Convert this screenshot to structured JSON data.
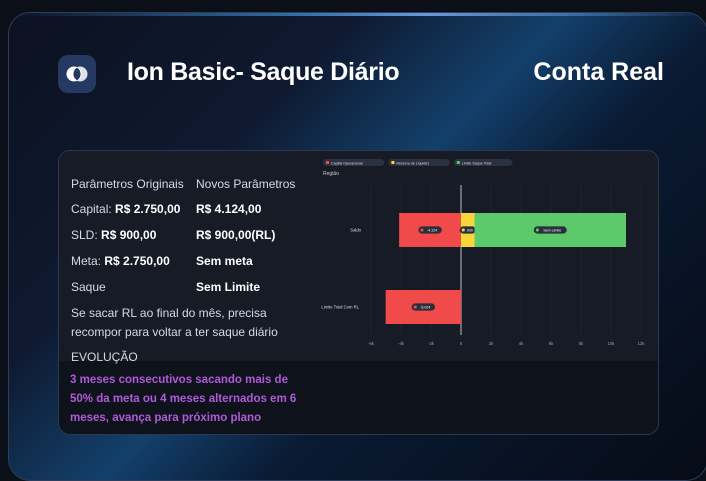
{
  "header": {
    "title": "Ion Basic- Saque Diário",
    "account_type": "Conta Real"
  },
  "params": {
    "col1_header": "Parâmetros Originais",
    "col2_header": "Novos Parâmetros",
    "capital_label": "Capital:",
    "capital_original": "R$ 2.750,00",
    "capital_new": "R$ 4.124,00",
    "sld_label": "SLD:",
    "sld_original": "R$ 900,00",
    "sld_new": "R$ 900,00(RL)",
    "meta_label": "Meta:",
    "meta_original": "R$ 2.750,00",
    "meta_new": "Sem meta",
    "saque_label": "Saque",
    "saque_new": "Sem Limite",
    "note_line1": "Se sacar RL ao final do mês, precisa",
    "note_line2": "recompor para voltar a ter saque diário",
    "evolucao": "EVOLUÇÃO"
  },
  "footer_note": "3 meses consecutivos sacando mais de 50% da meta ou 4 meses alternados em 6 meses, avança para próximo plano",
  "colors": {
    "red": "#f04a4a",
    "yellow": "#f7d63c",
    "green": "#5cc96b",
    "purple_note": "#b05ad9"
  },
  "chart_data": {
    "type": "bar",
    "orientation": "horizontal",
    "stacked": true,
    "title": "Região",
    "legend": [
      "Capital Operacional",
      "Reserva de Liquidez",
      "Limite Saque Total"
    ],
    "legend_placement": "top-left",
    "categories": [
      "Saldo",
      "Limite Total Com RL"
    ],
    "series": [
      {
        "name": "Capital Operacional",
        "color": "#f04a4a",
        "values": [
          -4.124,
          -5.024
        ],
        "labels": [
          "-4,124",
          "-5,024"
        ]
      },
      {
        "name": "Reserva de Liquidez",
        "color": "#f7d63c",
        "values": [
          0.9,
          0
        ],
        "labels": [
          "900",
          ""
        ]
      },
      {
        "name": "Limite Saque Total",
        "color": "#5cc96b",
        "values": [
          10.1,
          0
        ],
        "labels": [
          "Sem Limite",
          ""
        ]
      }
    ],
    "x_ticks": [
      "-6k",
      "-4k",
      "-2k",
      "0",
      "2k",
      "4k",
      "6k",
      "8k",
      "10k",
      "12k"
    ],
    "xlim": [
      -6,
      12
    ],
    "grid": true
  }
}
